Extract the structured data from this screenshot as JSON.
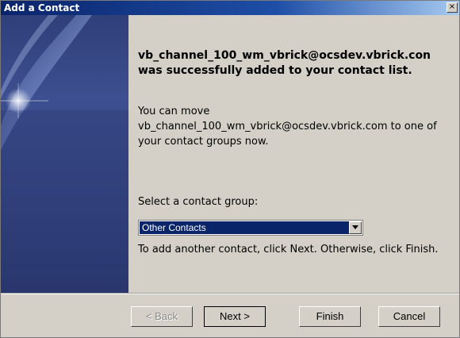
{
  "window": {
    "title": "Add a Contact",
    "close_glyph": "×"
  },
  "content": {
    "headline": "vb_channel_100_wm_vbrick@ocsdev.vbrick.con was successfully added to your contact list.",
    "body": "You can move vb_channel_100_wm_vbrick@ocsdev.vbrick.com to one of your contact groups now.",
    "select_label": "Select a contact group:",
    "group_selected": "Other Contacts",
    "hint": "To add another contact, click Next. Otherwise, click Finish."
  },
  "buttons": {
    "back": "< Back",
    "next": "Next >",
    "finish": "Finish",
    "cancel": "Cancel"
  },
  "icons": {
    "close": "close-icon",
    "dropdown": "chevron-down-icon"
  },
  "colors": {
    "title_bar": "#0a246a",
    "side_panel": "#33427e",
    "selection": "#0a246a"
  }
}
